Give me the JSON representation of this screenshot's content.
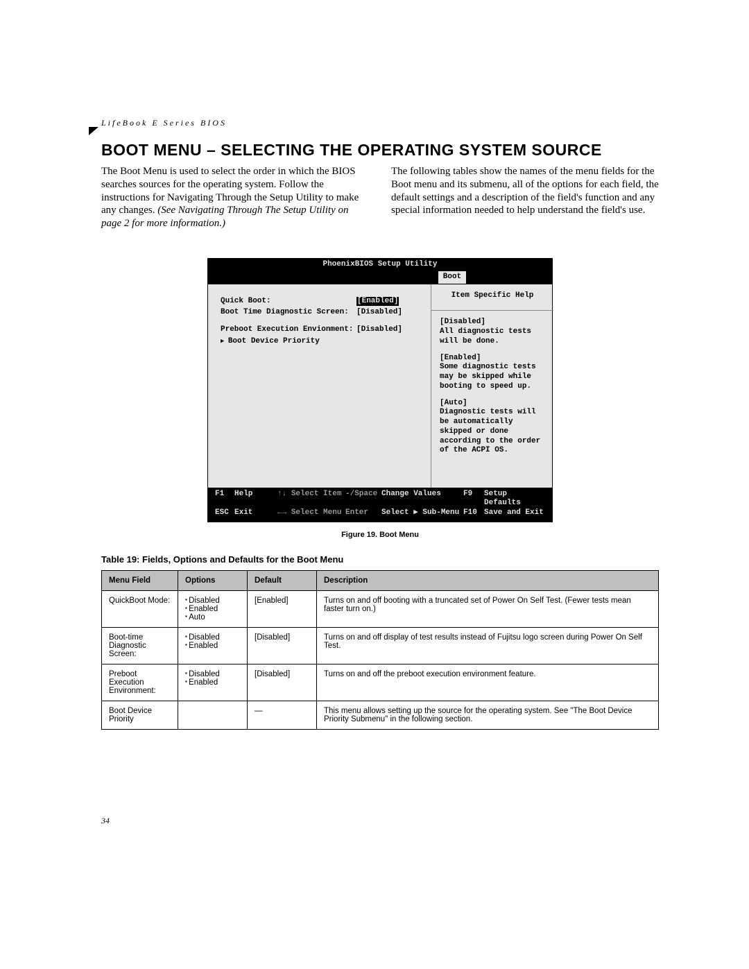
{
  "header_label": "LifeBook E Series BIOS",
  "heading": "BOOT MENU – SELECTING THE OPERATING SYSTEM SOURCE",
  "para_left_1": "The Boot Menu is used to select the order in which the BIOS searches sources for the operating system. Follow the instructions for Navigating Through the Setup Utility to make any changes. ",
  "para_left_italic": "(See Navigating Through The Setup Utility on page 2 for more information.)",
  "para_right": "The following tables show the names of the menu fields for the Boot menu and its submenu, all of the options for each field, the default settings and a description of the field's function and any special information needed to help understand the field's use.",
  "bios": {
    "title": "PhoenixBIOS Setup Utility",
    "tab": "Boot",
    "fields": [
      {
        "label": "Quick Boot:",
        "value": "[Enabled]",
        "selected": true
      },
      {
        "label": "Boot Time Diagnostic Screen:",
        "value": "[Disabled]",
        "selected": false
      },
      {
        "label": "Preboot Execution Envionment:",
        "value": "[Disabled]",
        "selected": false
      }
    ],
    "submenu": "Boot Device Priority",
    "help_title": "Item Specific Help",
    "help_paras": [
      "[Disabled]\nAll diagnostic tests will be done.",
      "[Enabled]\nSome diagnostic tests may be skipped while booting to speed up.",
      "[Auto]\nDiagnostic tests will be automatically skipped or done according to the order of the ACPI OS."
    ],
    "footer": {
      "f1": "F1",
      "help": "Help",
      "select_item": "Select Item",
      "change_values_key": "-/Space",
      "change_values": "Change Values",
      "f9": "F9",
      "setup_defaults": "Setup Defaults",
      "esc": "ESC",
      "exit": "Exit",
      "select_menu": "Select Menu",
      "enter": "Enter",
      "select_submenu": "Select ▶ Sub-Menu",
      "f10": "F10",
      "save_exit": "Save and Exit",
      "updown": "↑↓",
      "leftright": "←→"
    }
  },
  "figure_caption": "Figure 19.  Boot Menu",
  "table_caption": "Table 19: Fields, Options and Defaults for the Boot Menu",
  "table": {
    "headers": [
      "Menu Field",
      "Options",
      "Default",
      "Description"
    ],
    "rows": [
      {
        "field": "QuickBoot Mode:",
        "options": [
          "Disabled",
          "Enabled",
          "Auto"
        ],
        "default": "[Enabled]",
        "desc": "Turns on and off booting with a truncated set of Power On Self Test. (Fewer tests mean faster turn on.)"
      },
      {
        "field": "Boot-time Diagnostic Screen:",
        "options": [
          "Disabled",
          "Enabled"
        ],
        "default": "[Disabled]",
        "desc": "Turns on and off display of test results instead of Fujitsu logo screen during Power On Self Test."
      },
      {
        "field": "Preboot Execution Environment:",
        "options": [
          "Disabled",
          "Enabled"
        ],
        "default": "[Disabled]",
        "desc": "Turns on and off the preboot execution environment feature."
      },
      {
        "field": "Boot Device Priority",
        "options": [],
        "default": "—",
        "desc": "This menu allows setting up the source for the operating system. See \"The Boot Device Priority Submenu\" in the following section."
      }
    ]
  },
  "page_number": "34"
}
